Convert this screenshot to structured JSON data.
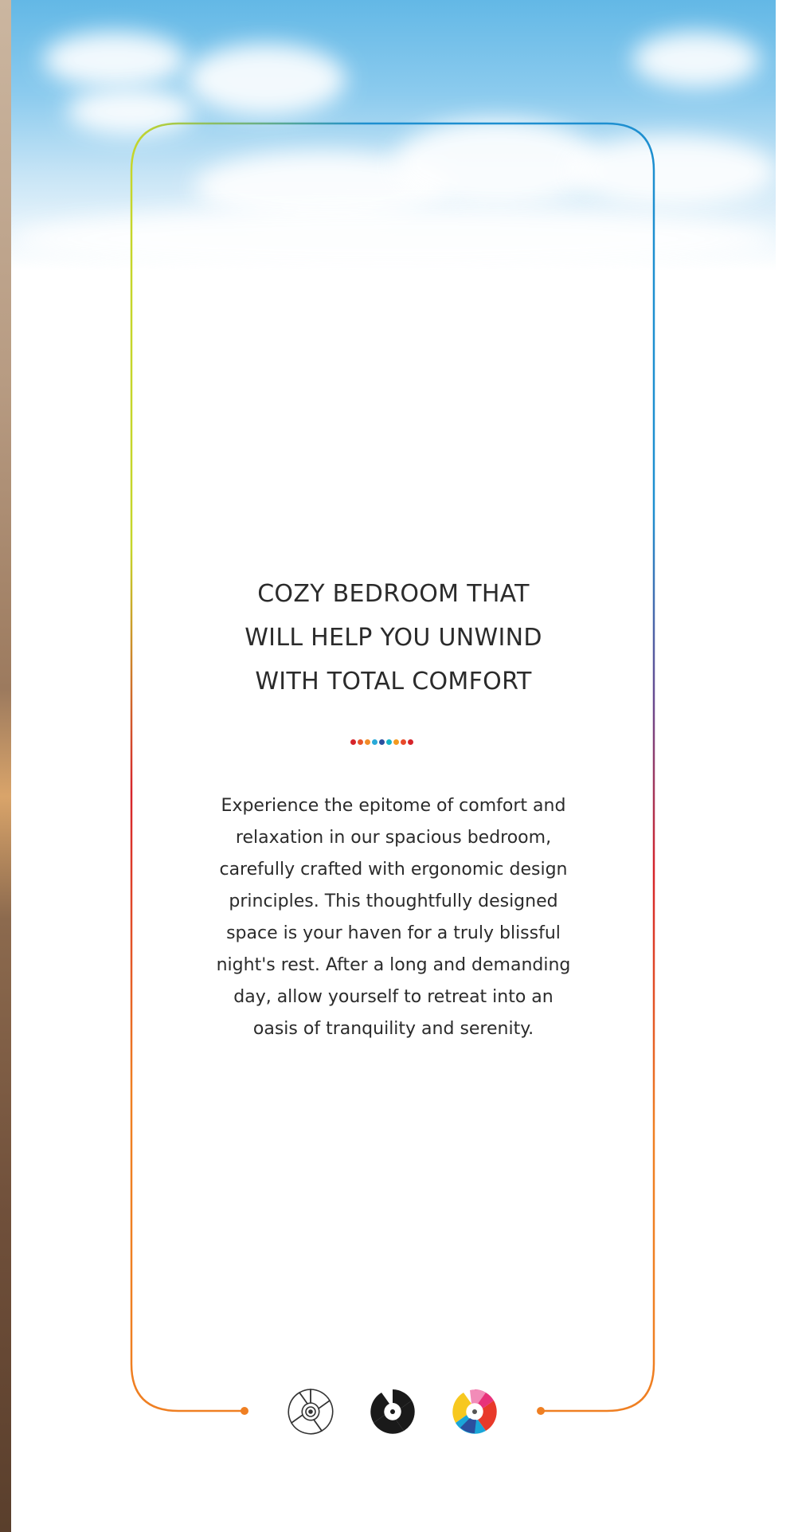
{
  "card": {
    "title_lines": [
      "COZY BEDROOM THAT",
      "WILL HELP YOU UNWIND",
      "WITH TOTAL COMFORT"
    ],
    "body_lines": [
      "Experience the epitome of comfort and",
      "relaxation in our spacious bedroom,",
      "carefully crafted with ergonomic design",
      "principles. This thoughtfully designed",
      "space is your haven for a truly blissful",
      "night's rest. After a long and demanding",
      "day, allow yourself to retreat into an",
      "oasis of tranquility and serenity."
    ],
    "divider_dot_colors": [
      "#d6242b",
      "#e8542a",
      "#f28c28",
      "#29a9d8",
      "#2b4f9e",
      "#14b4c8",
      "#f39a1f",
      "#e84a2a",
      "#d6242b"
    ]
  },
  "frame_colors": {
    "top_left": "#c6d62a",
    "top_right": "#1e8fd0",
    "middle_right": "#6a4a8f",
    "red": "#d6242b",
    "bottom": "#ef7f22"
  },
  "logos": [
    {
      "name": "outline-swirl-logo-icon",
      "style": "outline"
    },
    {
      "name": "black-swirl-logo-icon",
      "style": "solid-black"
    },
    {
      "name": "color-swirl-logo-icon",
      "style": "multicolor"
    }
  ]
}
